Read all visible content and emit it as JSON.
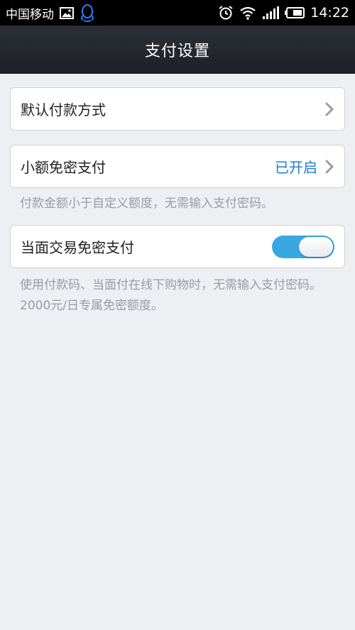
{
  "status_bar": {
    "carrier": "中国移动",
    "time": "14:22",
    "icons": [
      "image-icon",
      "qq-icon",
      "alarm-icon",
      "wifi-icon",
      "signal-icon",
      "battery-icon"
    ]
  },
  "header": {
    "title": "支付设置"
  },
  "settings": {
    "default_payment": {
      "label": "默认付款方式"
    },
    "small_amount": {
      "label": "小额免密支付",
      "value": "已开启",
      "hint": "付款金额小于自定义额度，无需输入支付密码。"
    },
    "face_to_face": {
      "label": "当面交易免密支付",
      "enabled": true,
      "hint": "使用付款码、当面付在线下购物时，无需输入支付密码。2000元/日专属免密额度。"
    }
  },
  "colors": {
    "accent": "#1f7bd1",
    "toggle_on": "#3aa7e1",
    "header_bg": "#23262d",
    "page_bg": "#eeeff3"
  }
}
